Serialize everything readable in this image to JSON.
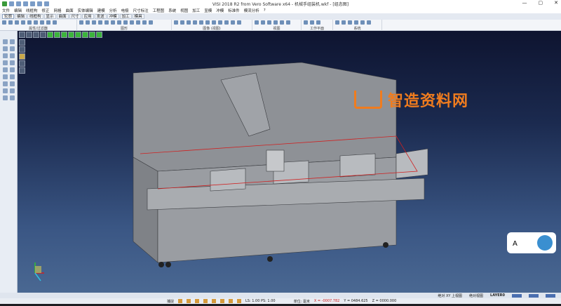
{
  "window": {
    "title": "VISI 2018 R2 from Vero Software x64 - 机械手组装机.wkf - [组态图]",
    "minimize": "—",
    "maximize": "▢",
    "close": "✕"
  },
  "menu": [
    "文件",
    "编辑",
    "线框构",
    "修正",
    "网格",
    "曲面",
    "实体编辑",
    "建模",
    "分析",
    "电极",
    "尺寸标注",
    "工程图",
    "系统",
    "视图",
    "加工",
    "显模",
    "冲模",
    "标准件",
    "模流分析",
    "?"
  ],
  "tabs": [
    "轮廓",
    "编辑",
    "线框构",
    "显示",
    "曲面",
    "尺寸",
    "应用",
    "发送",
    "冲模",
    "加工",
    "模具"
  ],
  "active_tab": "轮廓",
  "ribbon_groups": [
    "属性/过滤器",
    "图形",
    "图像 (视图)",
    "视图",
    "工作平面",
    "系统"
  ],
  "watermark": "智造资料网",
  "status": {
    "view": "绝对 XY 上视图",
    "abs_view": "绝对视图",
    "layer": "LAYER0",
    "snap": "捕捉",
    "scale": "LS: 1.00 PS: 1.00",
    "unit": "单位: 毫米",
    "x": "X = -0007.782",
    "y": "Y = 0484.625",
    "z": "Z = 0000.000"
  },
  "colors": {
    "accent": "#f07c1e",
    "viewport_top": "#0e1430",
    "viewport_bottom": "#4a6892"
  }
}
